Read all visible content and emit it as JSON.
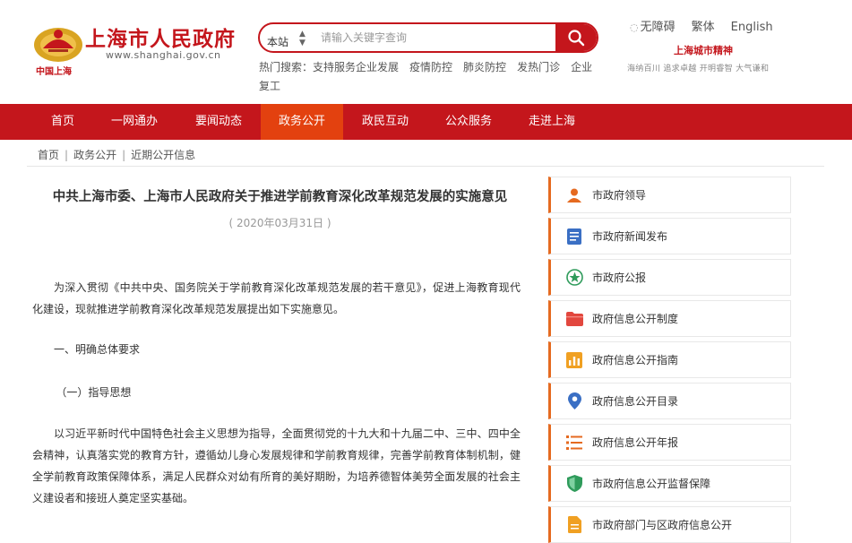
{
  "header": {
    "logo_sub": "中国上海",
    "title": "上海市人民政府",
    "url": "www.shanghai.gov.cn",
    "top_links": [
      "无障碍",
      "繁体",
      "English"
    ],
    "spirit_title": "上海城市精神",
    "spirit_text": "海纳百川 追求卓越 开明睿智 大气谦和"
  },
  "search": {
    "scope": "本站",
    "placeholder": "请输入关键字查询",
    "hot_label": "热门搜索：",
    "hot_terms": [
      "支持服务企业发展",
      "疫情防控",
      "肺炎防控",
      "发热门诊",
      "企业复工"
    ]
  },
  "nav": {
    "items": [
      "首页",
      "一网通办",
      "要闻动态",
      "政务公开",
      "政民互动",
      "公众服务",
      "走进上海"
    ],
    "active_index": 3
  },
  "breadcrumb": [
    "首页",
    "政务公开",
    "近期公开信息"
  ],
  "article": {
    "title": "中共上海市委、上海市人民政府关于推进学前教育深化改革规范发展的实施意见",
    "date": "( 2020年03月31日 )",
    "p1": "为深入贯彻《中共中央、国务院关于学前教育深化改革规范发展的若干意见》，促进上海教育现代化建设，现就推进学前教育深化改革规范发展提出如下实施意见。",
    "p2": "一、明确总体要求",
    "p3": "（一）指导思想",
    "p4": "以习近平新时代中国特色社会主义思想为指导，全面贯彻党的十九大和十九届二中、三中、四中全会精神，认真落实党的教育方针，遵循幼儿身心发展规律和学前教育规律，完善学前教育体制机制，健全学前教育政策保障体系，满足人民群众对幼有所育的美好期盼，为培养德智体美劳全面发展的社会主义建设者和接班人奠定坚实基础。"
  },
  "sidebar": {
    "items": [
      {
        "label": "市政府领导",
        "icon": "leader-icon",
        "color": "#e56a20"
      },
      {
        "label": "市政府新闻发布",
        "icon": "news-icon",
        "color": "#3a6fc4"
      },
      {
        "label": "市政府公报",
        "icon": "bulletin-icon",
        "color": "#2f9b5b"
      },
      {
        "label": "政府信息公开制度",
        "icon": "folder-icon",
        "color": "#e2473e"
      },
      {
        "label": "政府信息公开指南",
        "icon": "chart-icon",
        "color": "#f0a022"
      },
      {
        "label": "政府信息公开目录",
        "icon": "location-icon",
        "color": "#3a6fc4"
      },
      {
        "label": "政府信息公开年报",
        "icon": "list-icon",
        "color": "#e56a20"
      },
      {
        "label": "市政府信息公开监督保障",
        "icon": "shield-icon",
        "color": "#2f9b5b"
      },
      {
        "label": "市政府部门与区政府信息公开",
        "icon": "document-icon",
        "color": "#f0a022"
      }
    ]
  },
  "colors": {
    "brand": "#c4161c",
    "nav_active": "#e3410f",
    "sidebar_accent": "#e56a20"
  }
}
